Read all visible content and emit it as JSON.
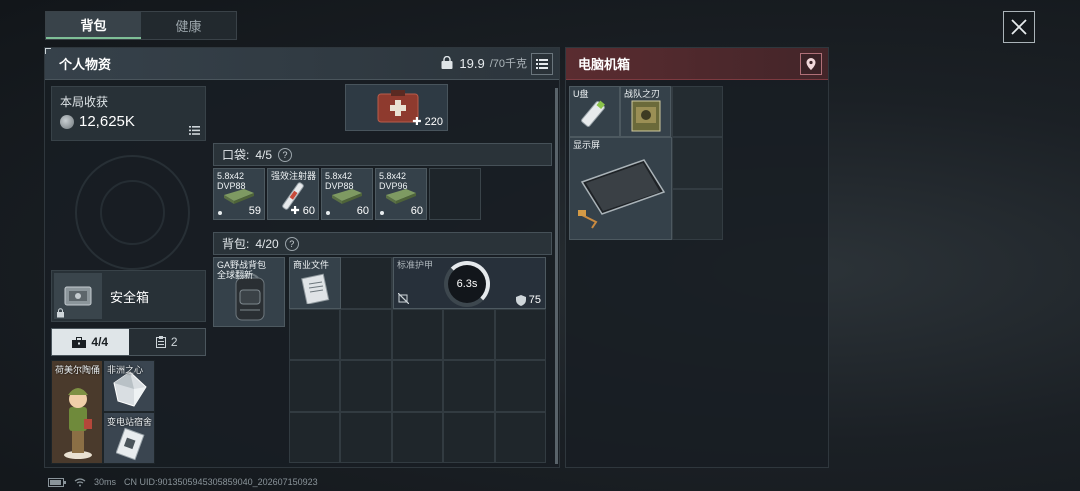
{
  "tabs": [
    {
      "label": "背包",
      "active": true
    },
    {
      "label": "健康",
      "active": false
    }
  ],
  "left_panel": {
    "title": "个人物资",
    "weight_current": "19.9",
    "weight_max": "/70千克",
    "earnings_label": "本局收获",
    "earnings_value": "12,625K",
    "safebox_label": "安全箱",
    "subtabs": [
      {
        "label": "4/4",
        "icon": "toolbox-icon"
      },
      {
        "label": "2",
        "icon": "clipboard-icon"
      }
    ],
    "safebox_items": [
      {
        "name": "荷美尔陶俑"
      },
      {
        "name": "非洲之心"
      },
      {
        "name": "变电站宿舍"
      }
    ]
  },
  "medkit": {
    "count": "220"
  },
  "pocket": {
    "label": "口袋:",
    "count": "4/5",
    "items": [
      {
        "name_line1": "5.8x42",
        "name_line2": "DVP88",
        "count": "59",
        "type": "ammo"
      },
      {
        "name_line1": "强效注射器",
        "name_line2": "",
        "count": "60",
        "type": "medical"
      },
      {
        "name_line1": "5.8x42",
        "name_line2": "DVP88",
        "count": "60",
        "type": "ammo"
      },
      {
        "name_line1": "5.8x42",
        "name_line2": "DVP96",
        "count": "60",
        "type": "ammo"
      }
    ]
  },
  "backpack": {
    "label": "背包:",
    "count": "4/20",
    "bag_name_line1": "GA野战背包",
    "bag_name_line2": "全球翻新",
    "items": [
      {
        "name": "商业文件"
      },
      {
        "name": "标准护甲",
        "timer": "6.3s",
        "durability": "75"
      }
    ]
  },
  "right_panel": {
    "title": "电脑机箱",
    "items": [
      {
        "name": "U盘"
      },
      {
        "name": "战队之刃"
      },
      {
        "name": "显示屏"
      }
    ]
  },
  "status_bar": {
    "ping": "30ms",
    "uid": "CN UID:9013505945305859040_202607150923"
  },
  "colors": {
    "accent_green": "#7fbf97",
    "container_red": "#5a2c30",
    "panel_bg": "#181e23"
  }
}
